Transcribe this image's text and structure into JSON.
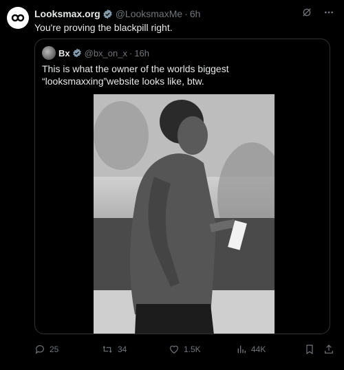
{
  "tweet": {
    "author_name": "Looksmax.org",
    "author_handle": "@LooksmaxMe",
    "separator": "·",
    "time": "6h",
    "text": "You're proving the blackpill right."
  },
  "quoted": {
    "author_name": "Bx",
    "author_handle": "@bx_on_x",
    "separator": "·",
    "time": "16h",
    "text": "This is what the owner of the worlds biggest “looksmaxxing”website looks like, btw."
  },
  "actions": {
    "replies": "25",
    "retweets": "34",
    "likes": "1.5K",
    "views": "44K"
  },
  "colors": {
    "background": "#000000",
    "text": "#e7e9ea",
    "muted": "#71767b",
    "verified": "#829aab",
    "border": "#2f3336"
  },
  "icons": [
    "grok-icon",
    "more-icon",
    "reply-icon",
    "retweet-icon",
    "like-icon",
    "views-icon",
    "bookmark-icon",
    "share-icon",
    "verified-badge-icon"
  ]
}
